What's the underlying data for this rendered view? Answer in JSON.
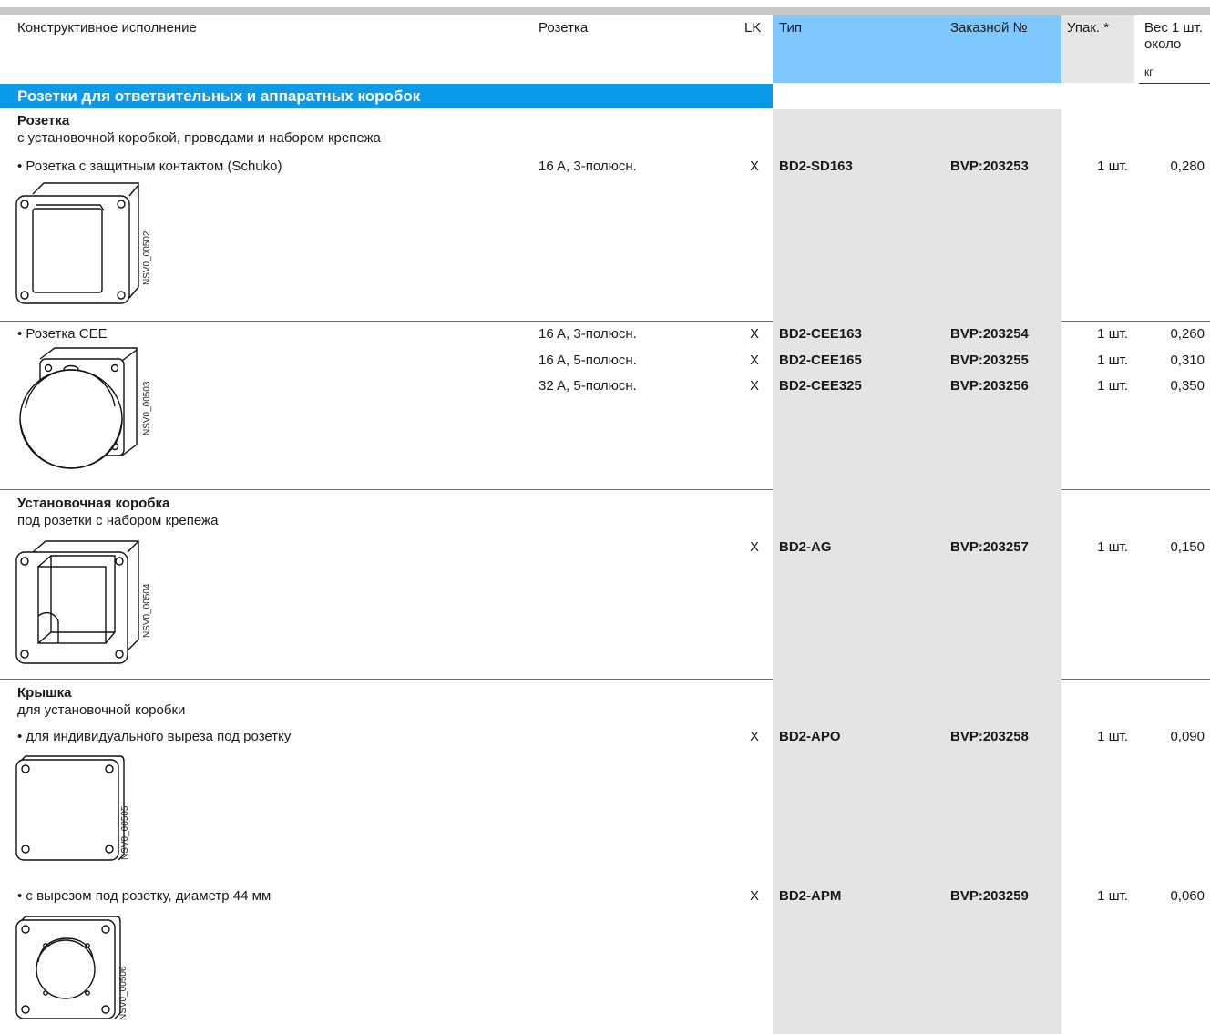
{
  "header": {
    "col_design": "Конструктивное исполнение",
    "col_socket": "Розетка",
    "col_lk": "LK",
    "col_type": "Тип",
    "col_order": "Заказной №",
    "col_pack": "Упак. *",
    "col_weight_1": "Вес 1 шт.",
    "col_weight_2": "около",
    "col_weight_unit": "кг"
  },
  "section_title": "Розетки для ответвительных и аппаратных коробок",
  "groups": {
    "socket": {
      "title": "Розетка",
      "subtitle": "с установочной коробкой, проводами и набором крепежа",
      "schuko": {
        "label": "• Розетка с защитным контактом (Schuko)",
        "figure": "NSV0_00502",
        "row": {
          "socket": "16 A, 3-полюсн.",
          "lk": "X",
          "type": "BD2-SD163",
          "order": "BVP:203253",
          "pack": "1 шт.",
          "weight": "0,280"
        }
      },
      "cee": {
        "label": "• Розетка CEE",
        "figure": "NSV0_00503",
        "rows": [
          {
            "socket": "16 A, 3-полюсн.",
            "lk": "X",
            "type": "BD2-CEE163",
            "order": "BVP:203254",
            "pack": "1 шт.",
            "weight": "0,260"
          },
          {
            "socket": "16 A, 5-полюсн.",
            "lk": "X",
            "type": "BD2-CEE165",
            "order": "BVP:203255",
            "pack": "1 шт.",
            "weight": "0,310"
          },
          {
            "socket": "32 A, 5-полюсн.",
            "lk": "X",
            "type": "BD2-CEE325",
            "order": "BVP:203256",
            "pack": "1 шт.",
            "weight": "0,350"
          }
        ]
      }
    },
    "box": {
      "title": "Установочная коробка",
      "subtitle": "под розетки с набором крепежа",
      "figure": "NSV0_00504",
      "row": {
        "lk": "X",
        "type": "BD2-AG",
        "order": "BVP:203257",
        "pack": "1 шт.",
        "weight": "0,150"
      }
    },
    "cover": {
      "title": "Крышка",
      "subtitle": "для установочной коробки",
      "individual": {
        "label": "• для индивидуального выреза под розетку",
        "figure": "NSV0_00505",
        "row": {
          "lk": "X",
          "type": "BD2-APO",
          "order": "BVP:203258",
          "pack": "1 шт.",
          "weight": "0,090"
        }
      },
      "cutout": {
        "label": "• с вырезом под розетку, диаметр 44 мм",
        "figure": "NSV0_00506",
        "row": {
          "lk": "X",
          "type": "BD2-APM",
          "order": "BVP:203259",
          "pack": "1 шт.",
          "weight": "0,060"
        }
      }
    }
  },
  "colors": {
    "accent_blue": "#0a9ae8",
    "header_blue": "#7fc8ff",
    "shade_grey": "#e4e4e4"
  }
}
